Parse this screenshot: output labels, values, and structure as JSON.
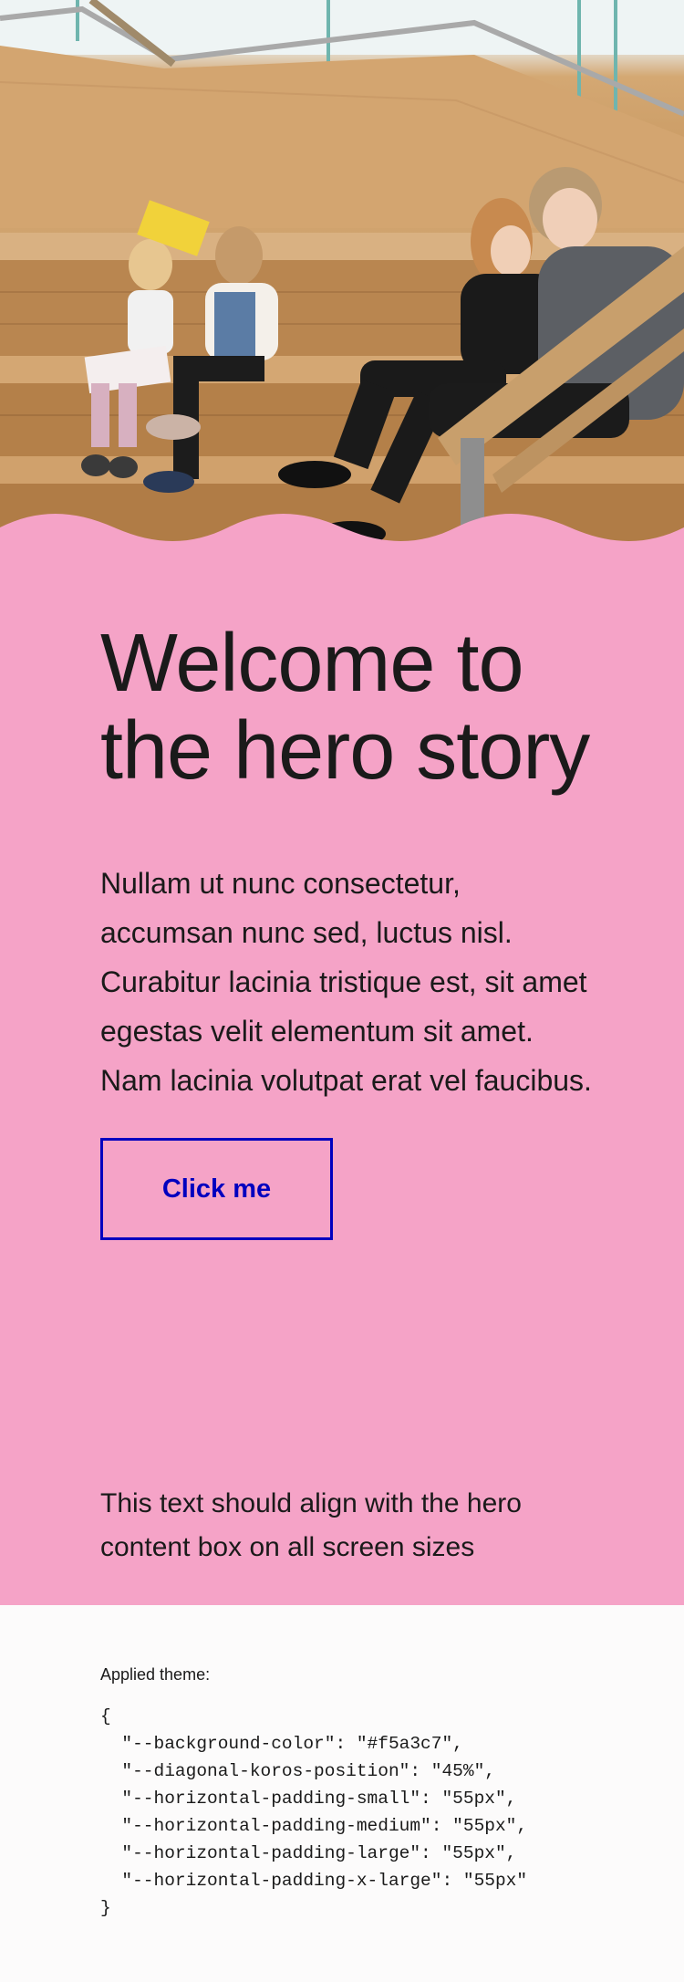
{
  "hero": {
    "image_alt": "People reading and using phones on wooden library stairs",
    "title": "Welcome to the hero story",
    "body": "Nullam ut nunc consectetur, accumsan nunc sed, luctus nisl. Curabitur lacinia tristique est, sit amet egestas velit elementum sit amet. Nam lacinia volutpat erat vel faucibus.",
    "button_label": "Click me",
    "align_text": "This text should align with the hero content box on all screen sizes"
  },
  "theme": {
    "label": "Applied theme:",
    "code": "{\n  \"--background-color\": \"#f5a3c7\",\n  \"--diagonal-koros-position\": \"45%\",\n  \"--horizontal-padding-small\": \"55px\",\n  \"--horizontal-padding-medium\": \"55px\",\n  \"--horizontal-padding-large\": \"55px\",\n  \"--horizontal-padding-x-large\": \"55px\"\n}"
  },
  "colors": {
    "hero_background": "#f5a3c7",
    "button_accent": "#0000bf",
    "page_background": "#fcfbfb"
  }
}
